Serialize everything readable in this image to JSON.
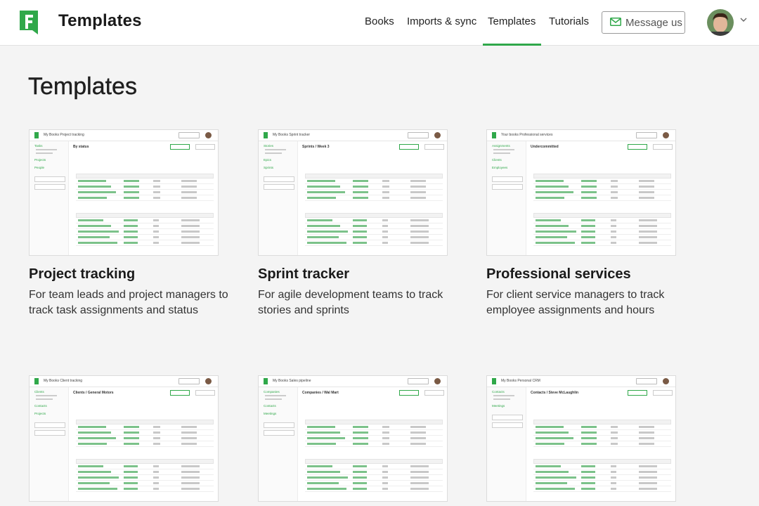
{
  "header": {
    "app_title": "Templates",
    "nav": [
      {
        "label": "Books"
      },
      {
        "label": "Imports & sync"
      },
      {
        "label": "Templates",
        "active": true
      },
      {
        "label": "Tutorials"
      }
    ],
    "message_button": "Message us",
    "accent_color": "#30a84a"
  },
  "page_title": "Templates",
  "templates": [
    {
      "title": "Project tracking",
      "description": "For team leads and project managers to track task assignments and status",
      "preview": {
        "breadcrumb": "My Books   Project tracking",
        "heading": "By status",
        "sidebar": [
          "Tasks",
          "Projects",
          "People"
        ]
      }
    },
    {
      "title": "Sprint tracker",
      "description": "For agile development teams to track stories and sprints",
      "preview": {
        "breadcrumb": "My Books   Sprint tracker",
        "heading": "Sprints  /  Week 3",
        "sidebar": [
          "Stories",
          "Epics",
          "Sprints"
        ]
      }
    },
    {
      "title": "Professional services",
      "description": "For client service managers to track employee assignments and hours",
      "preview": {
        "breadcrumb": "Your books   Professional services",
        "heading": "Undercommitted",
        "sidebar": [
          "Assignments",
          "Clients",
          "Employees"
        ]
      }
    },
    {
      "title": "",
      "description": "",
      "preview": {
        "breadcrumb": "My Books   Client tracking",
        "heading": "Clients  /  General Motors",
        "sidebar": [
          "Clients",
          "Contacts",
          "Projects"
        ]
      }
    },
    {
      "title": "",
      "description": "",
      "preview": {
        "breadcrumb": "My Books   Sales pipeline",
        "heading": "Companies  /  Wal Mart",
        "sidebar": [
          "Companies",
          "Contacts",
          "Meetings"
        ]
      }
    },
    {
      "title": "",
      "description": "",
      "preview": {
        "breadcrumb": "My Books   Personal CRM",
        "heading": "Contacts  /  Steve McLaughlin",
        "sidebar": [
          "Contacts",
          "Meetings"
        ]
      }
    }
  ]
}
